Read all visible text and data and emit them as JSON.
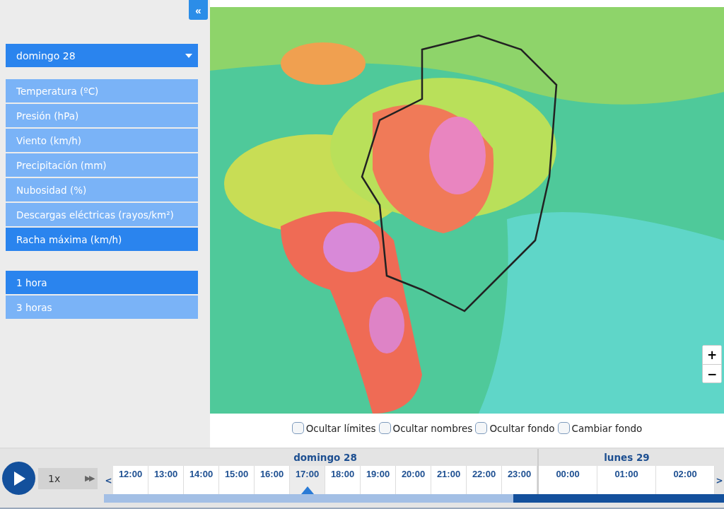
{
  "sidebar": {
    "collapse_button": "«",
    "day_select": {
      "value": "domingo 28"
    },
    "variables": [
      {
        "label": "Temperatura (ºC)",
        "selected": false
      },
      {
        "label": "Presión (hPa)",
        "selected": false
      },
      {
        "label": "Viento (km/h)",
        "selected": false
      },
      {
        "label": "Precipitación (mm)",
        "selected": false
      },
      {
        "label": "Nubosidad (%)",
        "selected": false
      },
      {
        "label": "Descargas eléctricas (rayos/km²)",
        "selected": false
      },
      {
        "label": "Racha máxima (km/h)",
        "selected": true
      }
    ],
    "intervals": [
      {
        "label": "1 hora",
        "selected": true
      },
      {
        "label": "3 horas",
        "selected": false
      }
    ]
  },
  "map": {
    "kind": "picture",
    "zoom_in": "+",
    "zoom_out": "−"
  },
  "options": [
    {
      "label": "Ocultar límites",
      "checked": false
    },
    {
      "label": "Ocultar nombres",
      "checked": false
    },
    {
      "label": "Ocultar fondo",
      "checked": false
    },
    {
      "label": "Cambiar fondo",
      "checked": false
    }
  ],
  "player": {
    "speed": "1x",
    "fast_forward": "▶▶"
  },
  "timeline": {
    "prev": "<",
    "next": ">",
    "level": 0.66,
    "days": [
      {
        "label": "domingo 28",
        "hours": [
          {
            "label": "12:00",
            "selected": false
          },
          {
            "label": "13:00",
            "selected": false
          },
          {
            "label": "14:00",
            "selected": false
          },
          {
            "label": "15:00",
            "selected": false
          },
          {
            "label": "16:00",
            "selected": false
          },
          {
            "label": "17:00",
            "selected": true
          },
          {
            "label": "18:00",
            "selected": false
          },
          {
            "label": "19:00",
            "selected": false
          },
          {
            "label": "20:00",
            "selected": false
          },
          {
            "label": "21:00",
            "selected": false
          },
          {
            "label": "22:00",
            "selected": false
          },
          {
            "label": "23:00",
            "selected": false
          }
        ]
      },
      {
        "label": "lunes 29",
        "hours": [
          {
            "label": "00:00",
            "selected": false
          },
          {
            "label": "01:00",
            "selected": false
          },
          {
            "label": "02:00",
            "selected": false
          }
        ]
      }
    ]
  }
}
